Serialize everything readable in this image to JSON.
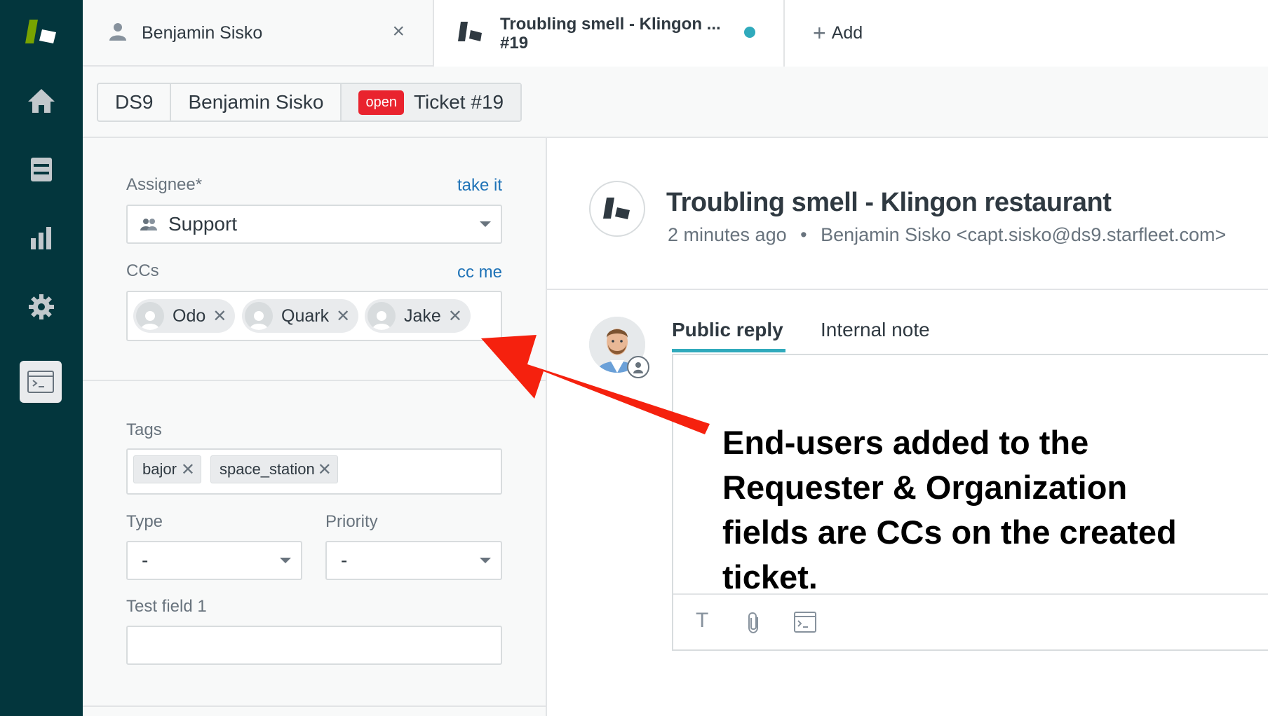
{
  "tabs": {
    "user_tab": "Benjamin Sisko",
    "ticket_tab_line1": "Troubling smell - Klingon ...",
    "ticket_tab_line2": "#19",
    "add_tab": "Add",
    "close_symbol": "×",
    "add_symbol": "+"
  },
  "breadcrumbs": {
    "org": "DS9",
    "user": "Benjamin Sisko",
    "status_badge": "open",
    "ticket": "Ticket #19"
  },
  "form": {
    "assignee_label": "Assignee*",
    "take_it": "take it",
    "assignee_value": "Support",
    "ccs_label": "CCs",
    "cc_me": "cc me",
    "ccs": [
      "Odo",
      "Quark",
      "Jake"
    ],
    "tags_label": "Tags",
    "tags": [
      "bajor",
      "space_station"
    ],
    "type_label": "Type",
    "type_value": "-",
    "priority_label": "Priority",
    "priority_value": "-",
    "test_field_label": "Test field 1",
    "test_field_value": ""
  },
  "ticket": {
    "title": "Troubling smell - Klingon restaurant",
    "time": "2 minutes ago",
    "separator": "•",
    "requester": "Benjamin Sisko <capt.sisko@ds9.starfleet.com>"
  },
  "reply": {
    "public_tab": "Public reply",
    "internal_tab": "Internal note",
    "text_tool": "T"
  },
  "annotation": {
    "line1": "End-users added to the",
    "line2": "Requester & Organization",
    "line3": "fields are CCs on the created",
    "line4": "ticket."
  },
  "colors": {
    "nav_bg": "#03363d",
    "brand_green": "#78a300",
    "accent_teal": "#30aabc",
    "badge_red": "#e9232e",
    "link_blue": "#1f73b7",
    "arrow_red": "#f5210e"
  },
  "icons": [
    "zendesk-logo-icon",
    "home-icon",
    "views-icon",
    "reporting-icon",
    "admin-gear-icon",
    "apps-console-icon",
    "user-icon",
    "close-icon",
    "ticket-logo-icon",
    "plus-icon",
    "group-icon",
    "chevron-down-icon",
    "text-format-icon",
    "attachment-icon",
    "macro-console-icon"
  ]
}
